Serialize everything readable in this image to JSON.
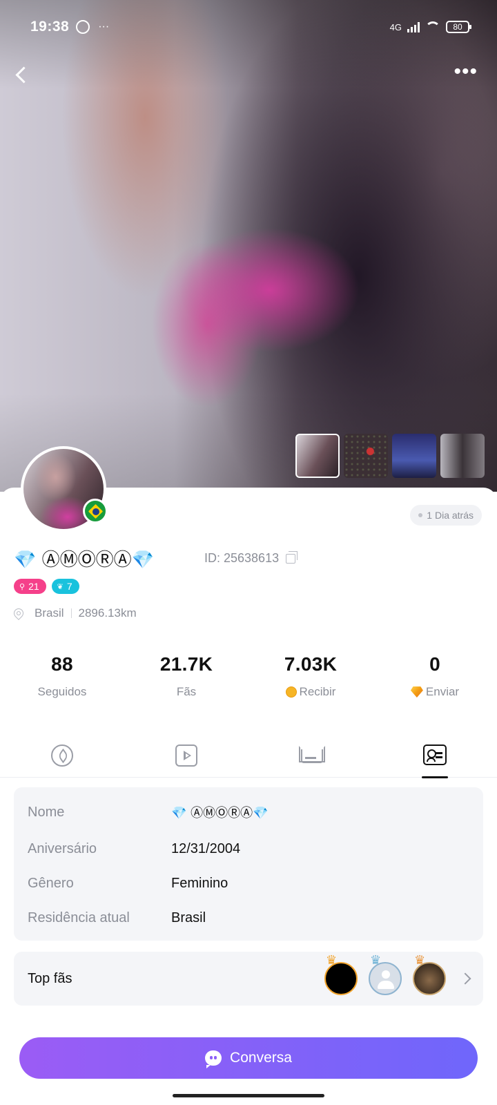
{
  "status_bar": {
    "time": "19:38",
    "network": "4G",
    "battery": "80"
  },
  "profile": {
    "name": "💎 ⒶⓂⓄⓇⒶ💎",
    "id_label": "ID: 25638613",
    "last_seen": "1 Dia atrás",
    "country_flag": "Brazil",
    "badges": [
      {
        "value": "21",
        "color": "#f5408a",
        "icon": "gender-icon"
      },
      {
        "value": "7",
        "color": "#19c2dd",
        "icon": "sprout-icon"
      }
    ],
    "location": "Brasil",
    "distance": "2896.13km"
  },
  "stats": [
    {
      "value": "88",
      "label": "Seguidos"
    },
    {
      "value": "21.7K",
      "label": "Fãs"
    },
    {
      "value": "7.03K",
      "label": "Recibir"
    },
    {
      "value": "0",
      "label": "Enviar"
    }
  ],
  "tabs": [
    {
      "icon": "compass-icon"
    },
    {
      "icon": "video-icon"
    },
    {
      "icon": "crown-icon"
    },
    {
      "icon": "profile-card-icon",
      "active": true
    }
  ],
  "info": {
    "rows": [
      {
        "key": "Nome",
        "value": "💎 ⒶⓂⓄⓇⒶ💎"
      },
      {
        "key": "Aniversário",
        "value": "12/31/2004"
      },
      {
        "key": "Gênero",
        "value": "Feminino"
      },
      {
        "key": "Residência atual",
        "value": "Brasil"
      }
    ]
  },
  "top_fans": {
    "label": "Top fãs"
  },
  "cta": {
    "label": "Conversa"
  },
  "colors": {
    "accent_start": "#9b5cf5",
    "accent_end": "#6f66fb",
    "muted_text": "#8b8e97",
    "panel_bg": "#f4f5f8"
  }
}
